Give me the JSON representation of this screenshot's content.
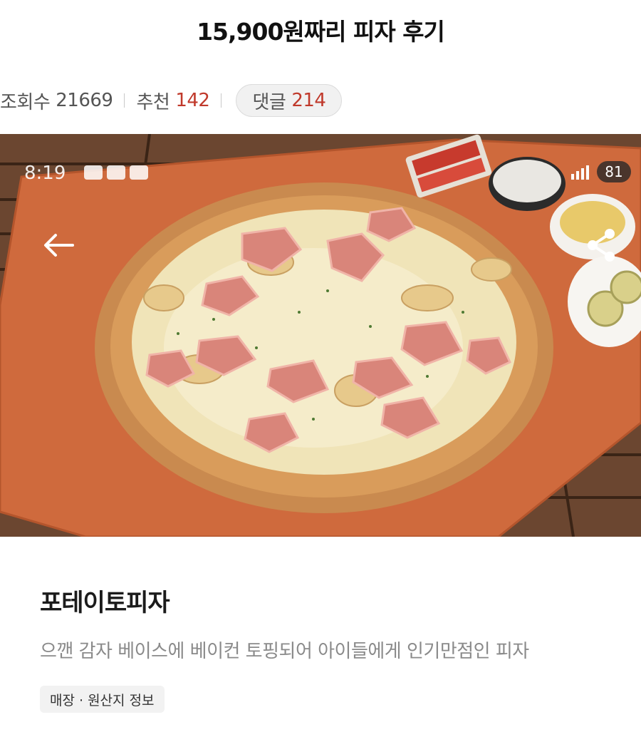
{
  "post": {
    "title": "15,900원짜리 피자 후기"
  },
  "meta": {
    "views_label": "조회수",
    "views_count": "21669",
    "recommend_label": "추천",
    "recommend_count": "142",
    "comments_label": "댓글",
    "comments_count": "214"
  },
  "screenshot_overlay": {
    "status_time": "8:19",
    "battery": "81",
    "back_icon": "arrow-left-icon",
    "share_icon": "share-icon"
  },
  "product": {
    "name": "포테이토피자",
    "description": "으깬 감자 베이스에 베이컨 토핑되어 아이들에게 인기만점인 피자",
    "info_tag": "매장 · 원산지 정보"
  },
  "colors": {
    "accent_red": "#c0392b",
    "muted_text": "#8a8a8a",
    "tag_background": "#f2f2f2"
  }
}
